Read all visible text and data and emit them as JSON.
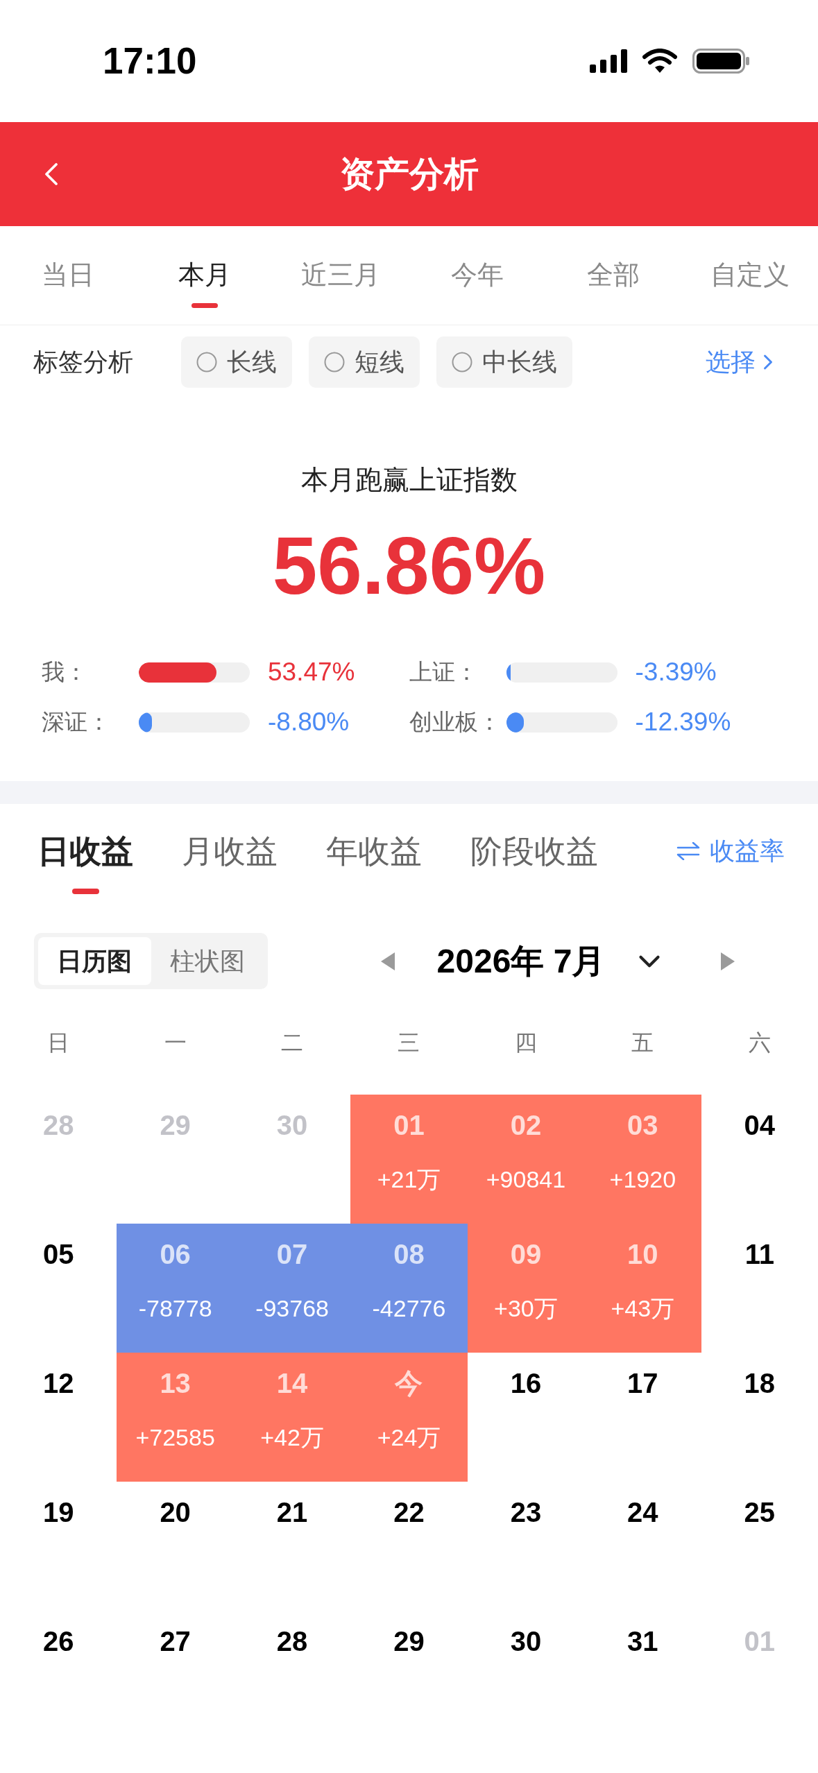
{
  "status_bar": {
    "time": "17:10"
  },
  "header": {
    "title": "资产分析"
  },
  "period_tabs": [
    {
      "label": "当日",
      "selected": false
    },
    {
      "label": "本月",
      "selected": true
    },
    {
      "label": "近三月",
      "selected": false
    },
    {
      "label": "今年",
      "selected": false
    },
    {
      "label": "全部",
      "selected": false
    },
    {
      "label": "自定义",
      "selected": false
    }
  ],
  "tag_filter": {
    "label": "标签分析",
    "tags": [
      {
        "label": "长线",
        "checked": false
      },
      {
        "label": "短线",
        "checked": false
      },
      {
        "label": "中长线",
        "checked": false
      }
    ],
    "select_link": "选择"
  },
  "benchmark": {
    "title": "本月跑赢上证指数",
    "value": "56.86%",
    "rows": [
      {
        "label": "我：",
        "level": 0.7,
        "reading": "53.47%",
        "color": "#e8323a"
      },
      {
        "label": "上证：",
        "level": 0.04,
        "reading": "-3.39%",
        "color": "#4a8af4"
      },
      {
        "label": "深证：",
        "level": 0.12,
        "reading": "-8.80%",
        "color": "#4a8af4"
      },
      {
        "label": "创业板：",
        "level": 0.16,
        "reading": "-12.39%",
        "color": "#4a8af4"
      }
    ]
  },
  "earnings_tabs": [
    {
      "label": "日收益",
      "selected": true
    },
    {
      "label": "月收益",
      "selected": false
    },
    {
      "label": "年收益",
      "selected": false
    },
    {
      "label": "阶段收益",
      "selected": false
    }
  ],
  "rate_toggle": {
    "label": "收益率"
  },
  "view_toggle": [
    {
      "label": "日历图",
      "selected": true
    },
    {
      "label": "柱状图",
      "selected": false
    }
  ],
  "calendar": {
    "month": "2026年 7月",
    "weekdays": [
      "日",
      "一",
      "二",
      "三",
      "四",
      "五",
      "六"
    ],
    "weeks": [
      [
        {
          "date": "28",
          "outside_month": true
        },
        {
          "date": "29",
          "outside_month": true
        },
        {
          "date": "30",
          "outside_month": true
        },
        {
          "date": "01",
          "outside_month": false,
          "change": "+21万",
          "color": "#ff7662"
        },
        {
          "date": "02",
          "outside_month": false,
          "change": "+90841",
          "color": "#ff7662"
        },
        {
          "date": "03",
          "outside_month": false,
          "change": "+1920",
          "color": "#ff7662"
        },
        {
          "date": "04",
          "outside_month": false
        }
      ],
      [
        {
          "date": "05",
          "outside_month": false
        },
        {
          "date": "06",
          "outside_month": false,
          "change": "-78778",
          "color": "#6f90e4"
        },
        {
          "date": "07",
          "outside_month": false,
          "change": "-93768",
          "color": "#6f90e4"
        },
        {
          "date": "08",
          "outside_month": false,
          "change": "-42776",
          "color": "#6f90e4"
        },
        {
          "date": "09",
          "outside_month": false,
          "change": "+30万",
          "color": "#ff7662"
        },
        {
          "date": "10",
          "outside_month": false,
          "change": "+43万",
          "color": "#ff7662"
        },
        {
          "date": "11",
          "outside_month": false
        }
      ],
      [
        {
          "date": "12",
          "outside_month": false
        },
        {
          "date": "13",
          "outside_month": false,
          "change": "+72585",
          "color": "#ff7662"
        },
        {
          "date": "14",
          "outside_month": false,
          "change": "+42万",
          "color": "#ff7662"
        },
        {
          "date": "今",
          "outside_month": false,
          "change": "+24万",
          "color": "#ff7662"
        },
        {
          "date": "16",
          "outside_month": false
        },
        {
          "date": "17",
          "outside_month": false
        },
        {
          "date": "18",
          "outside_month": false
        }
      ],
      [
        {
          "date": "19",
          "outside_month": false
        },
        {
          "date": "20",
          "outside_month": false
        },
        {
          "date": "21",
          "outside_month": false
        },
        {
          "date": "22",
          "outside_month": false
        },
        {
          "date": "23",
          "outside_month": false
        },
        {
          "date": "24",
          "outside_month": false
        },
        {
          "date": "25",
          "outside_month": false
        }
      ],
      [
        {
          "date": "26",
          "outside_month": false
        },
        {
          "date": "27",
          "outside_month": false
        },
        {
          "date": "28",
          "outside_month": false
        },
        {
          "date": "29",
          "outside_month": false
        },
        {
          "date": "30",
          "outside_month": false
        },
        {
          "date": "31",
          "outside_month": false
        },
        {
          "date": "01",
          "outside_month": true
        }
      ]
    ]
  }
}
